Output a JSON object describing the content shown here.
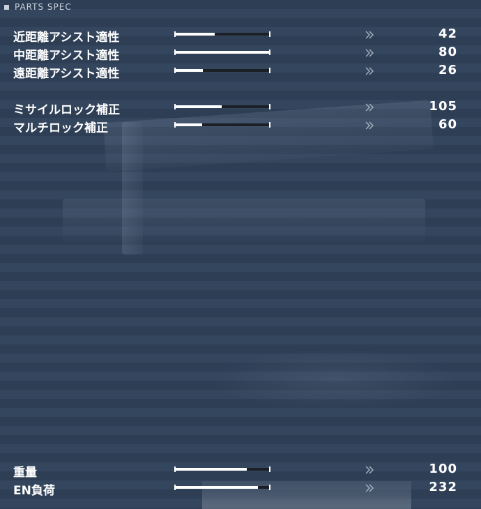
{
  "header": {
    "title": "PARTS SPEC"
  },
  "group_assist": [
    {
      "label": "近距離アシスト適性",
      "value": "42",
      "fill": 0.42
    },
    {
      "label": "中距離アシスト適性",
      "value": "80",
      "fill": 1.0
    },
    {
      "label": "遠距離アシスト適性",
      "value": "26",
      "fill": 0.3
    }
  ],
  "group_lock": [
    {
      "label": "ミサイルロック補正",
      "value": "105",
      "fill": 0.49
    },
    {
      "label": "マルチロック補正",
      "value": "60",
      "fill": 0.29
    }
  ],
  "group_load": [
    {
      "label": "重量",
      "value": "100",
      "fill": 0.75
    },
    {
      "label": "EN負荷",
      "value": "232",
      "fill": 0.87
    }
  ],
  "arrow_icon": "double-chevron-right-icon",
  "colors": {
    "bar_fill": "#ffffff",
    "bar_track": "#1b1f26",
    "stripe_a": "#2d3e55",
    "stripe_b": "#34465e"
  }
}
